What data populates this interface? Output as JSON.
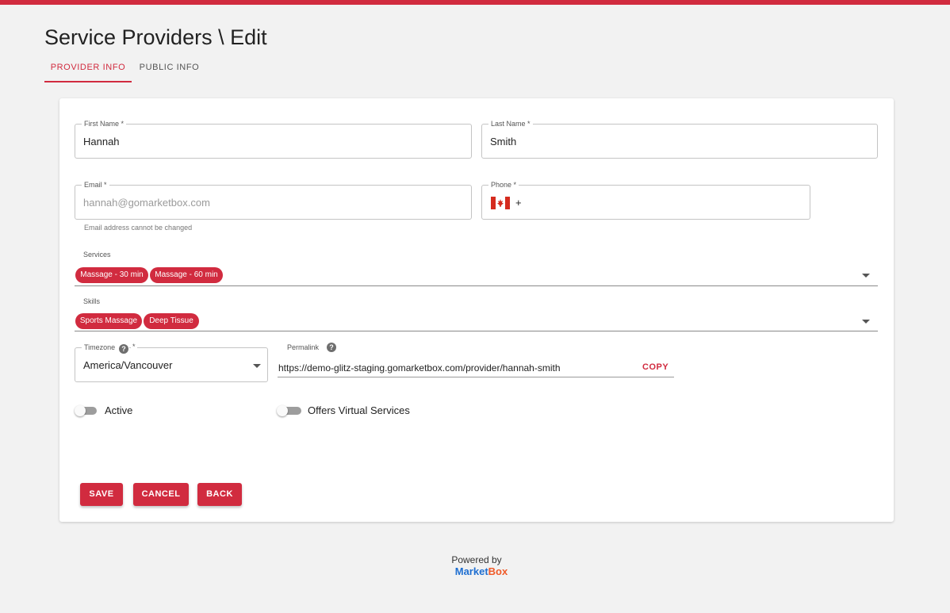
{
  "header": {
    "title": "Service Providers \\ Edit"
  },
  "tabs": [
    {
      "label": "PROVIDER INFO",
      "active": true
    },
    {
      "label": "PUBLIC INFO",
      "active": false
    }
  ],
  "form": {
    "first_name": {
      "label": "First Name *",
      "value": "Hannah"
    },
    "last_name": {
      "label": "Last Name *",
      "value": "Smith"
    },
    "email": {
      "label": "Email *",
      "value": "hannah@gomarketbox.com",
      "helper": "Email address cannot be changed"
    },
    "phone": {
      "label": "Phone *",
      "prefix": "+",
      "flag": "canada-flag-icon"
    },
    "services": {
      "label": "Services",
      "chips": [
        "Massage - 30 min",
        "Massage - 60 min"
      ]
    },
    "skills": {
      "label": "Skills",
      "chips": [
        "Sports Massage",
        "Deep Tissue"
      ]
    },
    "timezone": {
      "label": "Timezone",
      "required_mark": "*",
      "value": "America/Vancouver"
    },
    "permalink": {
      "label": "Permalink",
      "value": "https://demo-glitz-staging.gomarketbox.com/provider/hannah-smith",
      "copy_label": "COPY"
    },
    "active": {
      "label": "Active",
      "on": false
    },
    "virtual": {
      "label": "Offers Virtual Services",
      "on": false
    }
  },
  "actions": {
    "save": "SAVE",
    "cancel": "CANCEL",
    "back": "BACK"
  },
  "footer": {
    "powered_by": "Powered by",
    "brand_part1": "Market",
    "brand_part2": "Box"
  },
  "colors": {
    "accent": "#d12b3f",
    "brand_blue": "#1f6fd1",
    "brand_orange": "#f05a28"
  }
}
